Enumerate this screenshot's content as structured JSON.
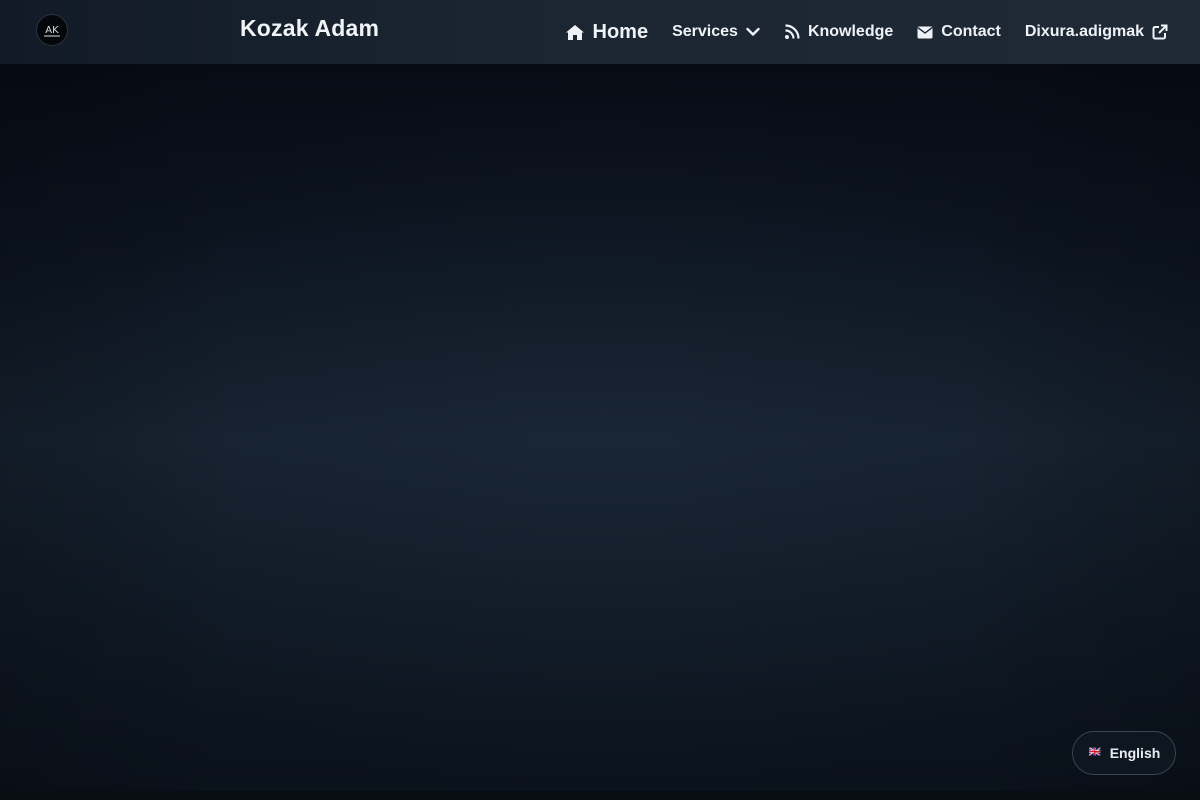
{
  "header": {
    "logo_text": "AK",
    "brand": "Kozak Adam",
    "nav": {
      "home": "Home",
      "services": "Services",
      "knowledge": "Knowledge",
      "contact": "Contact",
      "external": "Dixura.adigmak"
    }
  },
  "language": {
    "flag": "🇬🇧",
    "label": "English"
  },
  "icons": {
    "home": "home-icon",
    "services_toggle": "chevron-down-icon",
    "knowledge": "feed-icon",
    "contact": "envelope-icon",
    "external": "external-link-icon"
  }
}
